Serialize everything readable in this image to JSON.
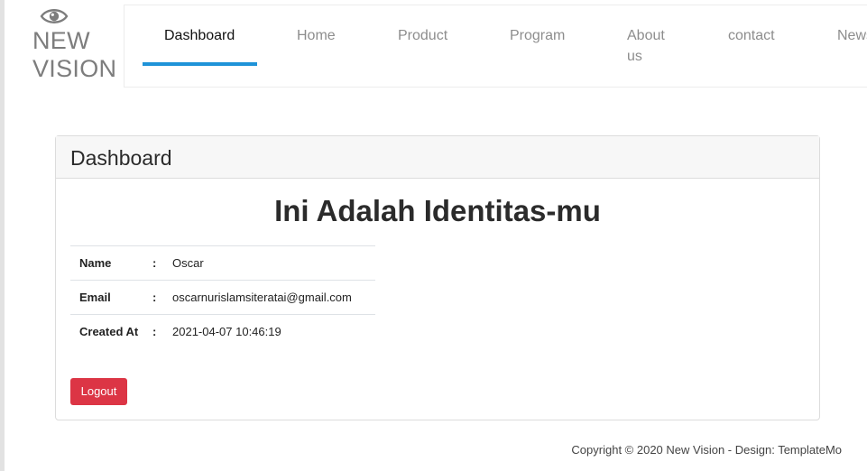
{
  "brand": {
    "icon": "eye-icon",
    "line1": "NEW",
    "line2": "VISION"
  },
  "nav": {
    "active": "Dashboard",
    "items": [
      "Dashboard",
      "Home",
      "Product",
      "Program",
      "About",
      "contact",
      "News"
    ],
    "about_line2": "us",
    "accent_color": "#1f93d8"
  },
  "card": {
    "header": "Dashboard",
    "heading": "Ini Adalah Identitas-mu",
    "rows": [
      {
        "label": "Name",
        "sep": ":",
        "value": "Oscar"
      },
      {
        "label": "Email",
        "sep": ":",
        "value": "oscarnurislamsiteratai@gmail.com"
      },
      {
        "label": "Created At",
        "sep": ":",
        "value": "2021-04-07 10:46:19"
      }
    ],
    "logout_label": "Logout",
    "logout_color": "#dc3545"
  },
  "footer": {
    "text": "Copyright © 2020 New Vision - Design: TemplateMo"
  }
}
